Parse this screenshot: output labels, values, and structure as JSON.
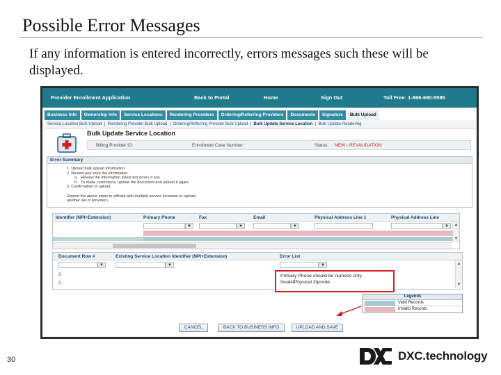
{
  "slide": {
    "title": "Possible Error Messages",
    "intro": "If any information is entered incorrectly, errors messages such these will be displayed.",
    "page_number": "30",
    "logo_text": "DXC.technology"
  },
  "app": {
    "header": {
      "title": "Provider Enrollment Application",
      "links": [
        "Back to Portal",
        "Home",
        "Sign Out"
      ],
      "tollfree": "Toll Free: 1-866-690-5585"
    },
    "tabs": [
      "Business Info",
      "Ownership Info",
      "Service Locations",
      "Rendering Providers",
      "Ordering/Referring Providers",
      "Documents",
      "Signature",
      "Bulk Upload"
    ],
    "subnav": [
      "Service Location Bulk Upload",
      "Rendering Provider Bulk Upload",
      "Ordering/Referring Provider Bulk Upload",
      "Bulk Update Service Location",
      "Bulk Update Rendering"
    ],
    "page_heading": "Bulk Update Service Location",
    "info": {
      "billing_label": "Billing Provider ID:",
      "case_label": "Enrollment Case Number:",
      "status_label": "Status:",
      "status_value": "NEW - REVALIDATION"
    },
    "error_summary": {
      "title": "Error Summary",
      "lines": [
        "1.   Upload bulk upload information.",
        "2.   Review and save the information.",
        "       a.   Review the information listed and errors if any.",
        "       b.   To make corrections, update the document and upload it again.",
        "3.   Confirmation of upload.",
        "",
        "Repeat the above steps to affiliate with multiple service locations or upload,",
        "another set of providers."
      ]
    },
    "grid1": {
      "headers": [
        "Identifier (NPI+Extension)",
        "Primary Phone",
        "Fax",
        "Email",
        "Physical Address Line 1",
        "Physical Address Line"
      ]
    },
    "grid2": {
      "headers": [
        "Document Row #",
        "Existing Service Location Identifier (NPI+Extension)",
        "Error List"
      ],
      "rows": [
        "2",
        "2"
      ],
      "errors": [
        "Primary Phone should be numeric only",
        "InvalidPhysical Zipcode"
      ]
    },
    "legend": {
      "title": "Legends",
      "items": [
        {
          "label": "Valid Records",
          "color": "#a8c9cd"
        },
        {
          "label": "InValid Records",
          "color": "#e8b8c2"
        }
      ]
    },
    "buttons": [
      "CANCEL",
      "BACK TO BUSINESS INFO",
      "UPLOAD AND SAVE"
    ],
    "colors": {
      "header": "#1f7a8c",
      "tab": "#2f8ba0",
      "error_highlight": "#d42020",
      "arrow": "#d42020"
    }
  }
}
